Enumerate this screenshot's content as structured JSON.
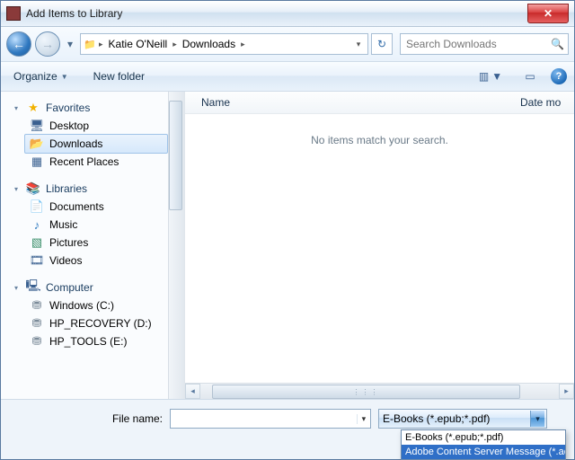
{
  "window": {
    "title": "Add Items to Library",
    "close_glyph": "✕"
  },
  "nav": {
    "back_glyph": "←",
    "fwd_glyph": "→",
    "history_glyph": "▾",
    "crumb_folder_glyph": "📁",
    "crumb_sep": "▸",
    "segments": [
      "Katie O'Neill",
      "Downloads"
    ],
    "drop_glyph": "▾",
    "refresh_glyph": "↻",
    "search_placeholder": "Search Downloads",
    "search_icon": "🔍"
  },
  "toolbar": {
    "organize": "Organize",
    "newfolder": "New folder",
    "dd_glyph": "▼",
    "view_glyph": "▥",
    "preview_glyph": "▭",
    "help_glyph": "?"
  },
  "tree": {
    "expander_open": "▾",
    "expander_closed": "▸",
    "favorites": {
      "label": "Favorites",
      "icon": "★",
      "desktop": {
        "label": "Desktop",
        "icon": "🖥"
      },
      "downloads": {
        "label": "Downloads",
        "icon": "📂"
      },
      "recent": {
        "label": "Recent Places",
        "icon": "▦"
      }
    },
    "libraries": {
      "label": "Libraries",
      "icon": "📚",
      "documents": {
        "label": "Documents",
        "icon": "📄"
      },
      "music": {
        "label": "Music",
        "icon": "♪"
      },
      "pictures": {
        "label": "Pictures",
        "icon": "▧"
      },
      "videos": {
        "label": "Videos",
        "icon": "🎞"
      }
    },
    "computer": {
      "label": "Computer",
      "icon": "🖳",
      "c": {
        "label": "Windows (C:)",
        "icon": "⛃"
      },
      "d": {
        "label": "HP_RECOVERY (D:)",
        "icon": "⛃"
      },
      "e": {
        "label": "HP_TOOLS (E:)",
        "icon": "⛃"
      }
    }
  },
  "list": {
    "col_name": "Name",
    "col_date": "Date mo",
    "empty": "No items match your search."
  },
  "footer": {
    "filename_label": "File name:",
    "filename_value": "",
    "filetype_selected": "E-Books  (*.epub;*.pdf)",
    "options": [
      "E-Books  (*.epub;*.pdf)",
      "Adobe Content Server Message (*.acsm)"
    ],
    "dd_glyph": "▾"
  }
}
